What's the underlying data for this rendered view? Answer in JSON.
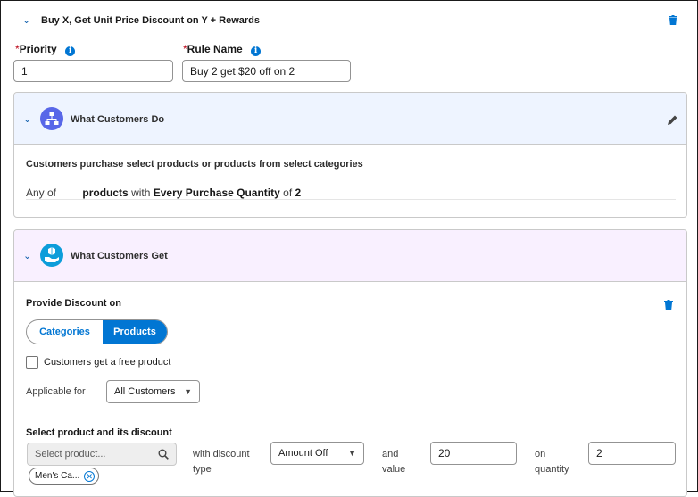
{
  "header": {
    "title": "Buy X, Get Unit Price Discount on Y + Rewards"
  },
  "priority": {
    "label": "Priority",
    "value": "1"
  },
  "rule_name": {
    "label": "Rule Name",
    "value": "Buy 2 get $20 off on 2"
  },
  "do_section": {
    "title": "What Customers Do",
    "description": "Customers purchase select products or products from select categories",
    "any_of": "Any of",
    "products": "products",
    "with": "with",
    "every_purchase": "Every Purchase Quantity",
    "of": "of",
    "qty": "2"
  },
  "get_section": {
    "title": "What Customers Get",
    "provide_label": "Provide Discount on",
    "toggle": {
      "categories": "Categories",
      "products": "Products",
      "selected": "Products"
    },
    "free_product_label": "Customers get a free product",
    "applicable_label": "Applicable for",
    "applicable_value": "All Customers",
    "select_label": "Select product and its discount",
    "search_placeholder": "Select product...",
    "chip": "Men's Ca...",
    "discount_label_1": "with discount",
    "discount_label_2": "type",
    "discount_type": "Amount Off",
    "and_label": "and",
    "value_label": "value",
    "value": "20",
    "on_label": "on",
    "quantity_label": "quantity",
    "quantity": "2"
  },
  "colors": {
    "accent": "#0176d3",
    "do_header_bg": "#eef4ff",
    "get_header_bg": "#f9f0ff",
    "icon_circle": "#5867e8"
  }
}
